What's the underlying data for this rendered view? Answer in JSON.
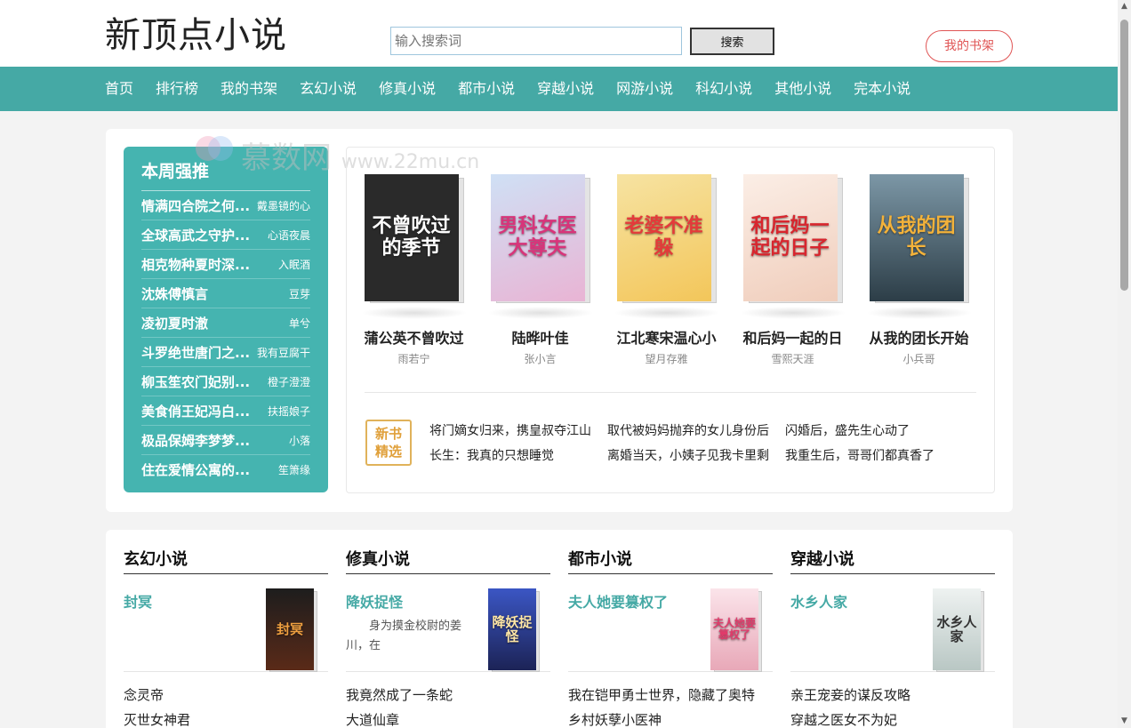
{
  "header": {
    "site_title": "新顶点小说",
    "search_placeholder": "输入搜索词",
    "search_value": "输入搜索词",
    "search_button": "搜索",
    "shelf_button": "我的书架"
  },
  "nav": {
    "items": [
      "首页",
      "排行榜",
      "我的书架",
      "玄幻小说",
      "修真小说",
      "都市小说",
      "穿越小说",
      "网游小说",
      "科幻小说",
      "其他小说",
      "完本小说"
    ]
  },
  "watermark": {
    "text": "慕数网",
    "url": "www.22mu.cn"
  },
  "weekly": {
    "title": "本周强推",
    "items": [
      {
        "title": "情满四合院之何...",
        "author": "戴墨镜的心"
      },
      {
        "title": "全球高武之守护...",
        "author": "心语夜晨"
      },
      {
        "title": "相克物种夏时深...",
        "author": "入眠酒"
      },
      {
        "title": "沈姝傅慎言",
        "author": "豆芽"
      },
      {
        "title": "凌初夏时澈",
        "author": "单兮"
      },
      {
        "title": "斗罗绝世唐门之...",
        "author": "我有豆腐干"
      },
      {
        "title": "柳玉笙农门妃别...",
        "author": "橙子澄澄"
      },
      {
        "title": "美食俏王妃冯白...",
        "author": "扶摇娘子"
      },
      {
        "title": "极品保姆李梦梦...",
        "author": "小落"
      },
      {
        "title": "住在爱情公寓的...",
        "author": "笙箫缘"
      }
    ]
  },
  "featured": {
    "books": [
      {
        "title": "蒲公英不曾吹过",
        "author": "雨若宁",
        "cover_text": "不曾吹过的季节",
        "cover_color": "#2a2a2a"
      },
      {
        "title": "陆晔叶佳",
        "author": "张小言",
        "cover_text": "男科女医大尊夫",
        "cover_color": "#e9b4d4"
      },
      {
        "title": "江北寒宋温心小",
        "author": "望月存雅",
        "cover_text": "老婆不准躲",
        "cover_color": "#f3d27a"
      },
      {
        "title": "和后妈一起的日",
        "author": "雪熙天涯",
        "cover_text": "和后妈一起的日子",
        "cover_color": "#f4d6c6"
      },
      {
        "title": "从我的团长开始",
        "author": "小兵哥",
        "cover_text": "从我的团长",
        "cover_color": "#3f5a6a"
      }
    ],
    "new_badge": "新书精选",
    "picks": [
      "将门嫡女归来，携皇叔夺江山",
      "取代被妈妈抛弃的女儿身份后",
      "闪婚后，盛先生心动了",
      "长生：我真的只想睡觉",
      "离婚当天，小姨子见我卡里剩",
      "我重生后，哥哥们都真香了"
    ]
  },
  "categories": [
    {
      "title": "玄幻小说",
      "feature_title": "封冥",
      "feature_desc": "",
      "cover_text": "封冥",
      "cover_color": "#3a2a22",
      "list": [
        "念灵帝",
        "灭世女神君"
      ]
    },
    {
      "title": "修真小说",
      "feature_title": "降妖捉怪",
      "feature_desc": "身为摸金校尉的姜川，在",
      "cover_text": "降妖捉怪",
      "cover_color": "#2e3d8a",
      "list": [
        "我竟然成了一条蛇",
        "大道仙章"
      ]
    },
    {
      "title": "都市小说",
      "feature_title": "夫人她要篡权了",
      "feature_desc": "",
      "cover_text": "夫人她要篡权了",
      "cover_color": "#e8b8c2",
      "list": [
        "我在铠甲勇士世界，隐藏了奥特",
        "乡村妖孽小医神"
      ]
    },
    {
      "title": "穿越小说",
      "feature_title": "水乡人家",
      "feature_desc": "",
      "cover_text": "水乡人家",
      "cover_color": "#cfd8d6",
      "list": [
        "亲王宠妾的谋反攻略",
        "穿越之医女不为妃"
      ]
    }
  ]
}
